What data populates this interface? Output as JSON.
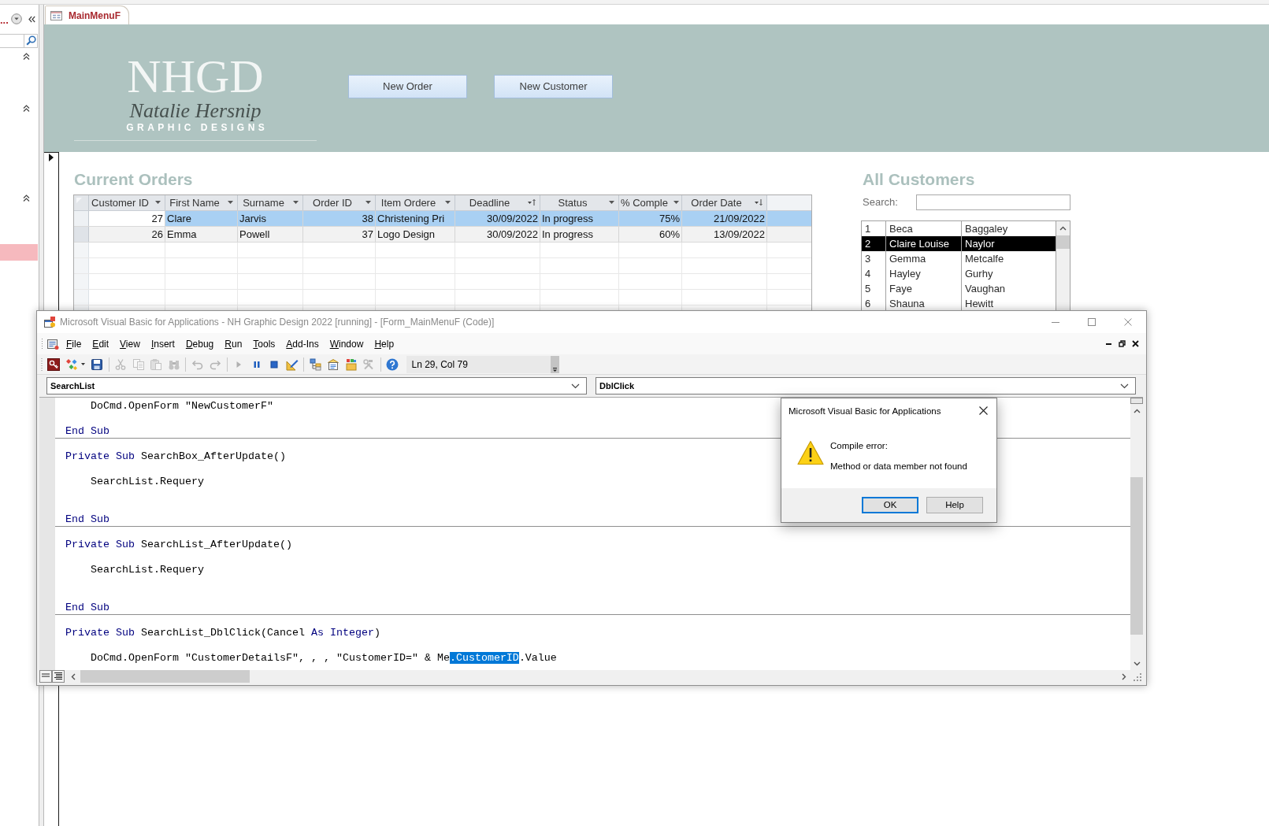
{
  "navigation_pane": {
    "title": "...",
    "groups": [
      {
        "expanded": true
      },
      {
        "expanded": true
      },
      {
        "expanded": true,
        "items": [
          {
            "selected": true
          }
        ]
      }
    ]
  },
  "tabs": [
    {
      "label": "MainMenuF",
      "selected": true
    }
  ],
  "form_header": {
    "logo": {
      "monogram": "NHGD",
      "signature": "Natalie Hersnip",
      "tagline": "GRAPHIC DESIGNS"
    },
    "buttons": [
      "New Order",
      "New Customer"
    ]
  },
  "current_orders": {
    "title": "Current Orders",
    "columns": [
      {
        "label": "Customer ID",
        "kind": "number",
        "sort_ascending": false,
        "sort_descending": false
      },
      {
        "label": "First Name",
        "kind": "text",
        "sort_ascending": false,
        "sort_descending": false
      },
      {
        "label": "Surname",
        "kind": "text",
        "sort_ascending": false,
        "sort_descending": false
      },
      {
        "label": "Order ID",
        "kind": "number",
        "sort_ascending": false,
        "sort_descending": false
      },
      {
        "label": "Item Ordere",
        "kind": "text",
        "sort_ascending": false,
        "sort_descending": false
      },
      {
        "label": "Deadline",
        "kind": "date",
        "sort_ascending": true,
        "sort_descending": false
      },
      {
        "label": "Status",
        "kind": "text",
        "sort_ascending": false,
        "sort_descending": false
      },
      {
        "label": "% Comple",
        "kind": "number",
        "sort_ascending": false,
        "sort_descending": false
      },
      {
        "label": "Order Date",
        "kind": "date",
        "sort_ascending": false,
        "sort_descending": true
      }
    ],
    "rows": [
      {
        "selected": true,
        "cells": [
          {
            "text": "27",
            "focused": true
          },
          {
            "text": "Clare",
            "focused": false
          },
          {
            "text": "Jarvis",
            "focused": false
          },
          {
            "text": "38",
            "focused": false
          },
          {
            "text": "Christening Pri",
            "focused": false
          },
          {
            "text": "30/09/2022",
            "focused": false
          },
          {
            "text": "In progress",
            "focused": false
          },
          {
            "text": "75%",
            "focused": false
          },
          {
            "text": "21/09/2022",
            "focused": false
          }
        ]
      },
      {
        "selected": false,
        "cells": [
          {
            "text": "26",
            "focused": false
          },
          {
            "text": "Emma",
            "focused": false
          },
          {
            "text": "Powell",
            "focused": false
          },
          {
            "text": "37",
            "focused": false
          },
          {
            "text": "Logo Design",
            "focused": false
          },
          {
            "text": "30/09/2022",
            "focused": false
          },
          {
            "text": "In progress",
            "focused": false
          },
          {
            "text": "60%",
            "focused": false
          },
          {
            "text": "13/09/2022",
            "focused": false
          }
        ]
      }
    ]
  },
  "all_customers": {
    "title": "All Customers",
    "search": {
      "label": "Search:"
    },
    "list": [
      {
        "selected": false,
        "cells": [
          "1",
          "Beca",
          "Baggaley"
        ]
      },
      {
        "selected": true,
        "cells": [
          "2",
          "Claire Louise",
          "Naylor"
        ]
      },
      {
        "selected": false,
        "cells": [
          "3",
          "Gemma",
          "Metcalfe"
        ]
      },
      {
        "selected": false,
        "cells": [
          "4",
          "Hayley",
          "Gurhy"
        ]
      },
      {
        "selected": false,
        "cells": [
          "5",
          "Faye",
          "Vaughan"
        ]
      },
      {
        "selected": false,
        "cells": [
          "6",
          "Shauna",
          "Hewitt"
        ]
      }
    ]
  },
  "vba_editor": {
    "title": "Microsoft Visual Basic for Applications - NH Graphic Design 2022 [running] - [Form_MainMenuF (Code)]",
    "menu": [
      "File",
      "Edit",
      "View",
      "Insert",
      "Debug",
      "Run",
      "Tools",
      "Add-Ins",
      "Window",
      "Help"
    ],
    "toolbar": [
      {
        "kind": "access",
        "disabled": false
      },
      {
        "kind": "insert",
        "disabled": false
      },
      {
        "kind": "save",
        "disabled": false
      },
      {
        "kind": "separator"
      },
      {
        "kind": "cut",
        "disabled": true
      },
      {
        "kind": "copy",
        "disabled": true
      },
      {
        "kind": "paste",
        "disabled": true
      },
      {
        "kind": "find",
        "disabled": true
      },
      {
        "kind": "separator"
      },
      {
        "kind": "undo",
        "disabled": true
      },
      {
        "kind": "redo",
        "disabled": true
      },
      {
        "kind": "separator"
      },
      {
        "kind": "run",
        "disabled": true
      },
      {
        "kind": "pause",
        "disabled": false
      },
      {
        "kind": "stop",
        "disabled": false
      },
      {
        "kind": "design",
        "disabled": false
      },
      {
        "kind": "separator"
      },
      {
        "kind": "project",
        "disabled": false
      },
      {
        "kind": "properties",
        "disabled": false
      },
      {
        "kind": "browser",
        "disabled": false
      },
      {
        "kind": "toolbox",
        "disabled": true
      },
      {
        "kind": "separator"
      },
      {
        "kind": "help",
        "disabled": false
      }
    ],
    "cursor_position": "Ln 29, Col 79",
    "object": "SearchList",
    "procedure": "DblClick",
    "code": [
      {
        "kind": "code",
        "separator_above": false,
        "segments": [
          {
            "kind": "plain",
            "text": "    DoCmd.OpenForm \"NewCustomerF\""
          }
        ]
      },
      {
        "kind": "blank",
        "separator_above": false
      },
      {
        "kind": "code",
        "separator_above": false,
        "segments": [
          {
            "kind": "keyword",
            "text": "End Sub"
          }
        ]
      },
      {
        "kind": "blank",
        "separator_above": true
      },
      {
        "kind": "code",
        "separator_above": false,
        "segments": [
          {
            "kind": "keyword",
            "text": "Private Sub"
          },
          {
            "kind": "plain",
            "text": " SearchBox_AfterUpdate()"
          }
        ]
      },
      {
        "kind": "blank",
        "separator_above": false
      },
      {
        "kind": "code",
        "separator_above": false,
        "segments": [
          {
            "kind": "plain",
            "text": "    SearchList.Requery"
          }
        ]
      },
      {
        "kind": "blank",
        "separator_above": false
      },
      {
        "kind": "blank",
        "separator_above": false
      },
      {
        "kind": "code",
        "separator_above": false,
        "segments": [
          {
            "kind": "keyword",
            "text": "End Sub"
          }
        ]
      },
      {
        "kind": "blank",
        "separator_above": true
      },
      {
        "kind": "code",
        "separator_above": false,
        "segments": [
          {
            "kind": "keyword",
            "text": "Private Sub"
          },
          {
            "kind": "plain",
            "text": " SearchList_AfterUpdate()"
          }
        ]
      },
      {
        "kind": "blank",
        "separator_above": false
      },
      {
        "kind": "code",
        "separator_above": false,
        "segments": [
          {
            "kind": "plain",
            "text": "    SearchList.Requery"
          }
        ]
      },
      {
        "kind": "blank",
        "separator_above": false
      },
      {
        "kind": "blank",
        "separator_above": false
      },
      {
        "kind": "code",
        "separator_above": false,
        "segments": [
          {
            "kind": "keyword",
            "text": "End Sub"
          }
        ]
      },
      {
        "kind": "blank",
        "separator_above": true
      },
      {
        "kind": "code",
        "separator_above": false,
        "segments": [
          {
            "kind": "keyword",
            "text": "Private Sub"
          },
          {
            "kind": "plain",
            "text": " SearchList_DblClick(Cancel "
          },
          {
            "kind": "keyword",
            "text": "As Integer"
          },
          {
            "kind": "plain",
            "text": ")"
          }
        ]
      },
      {
        "kind": "blank",
        "separator_above": false
      },
      {
        "kind": "code",
        "separator_above": false,
        "segments": [
          {
            "kind": "plain",
            "text": "    DoCmd.OpenForm \"CustomerDetailsF\", , , \"CustomerID=\" & Me"
          },
          {
            "kind": "selection",
            "text": ".CustomerID"
          },
          {
            "kind": "plain",
            "text": ".Value"
          }
        ]
      }
    ]
  },
  "dialog": {
    "title": "Microsoft Visual Basic for Applications",
    "heading": "Compile error:",
    "message": "Method or data member not found",
    "buttons": [
      {
        "label": "OK",
        "default": true
      },
      {
        "label": "Help",
        "default": false
      }
    ]
  }
}
